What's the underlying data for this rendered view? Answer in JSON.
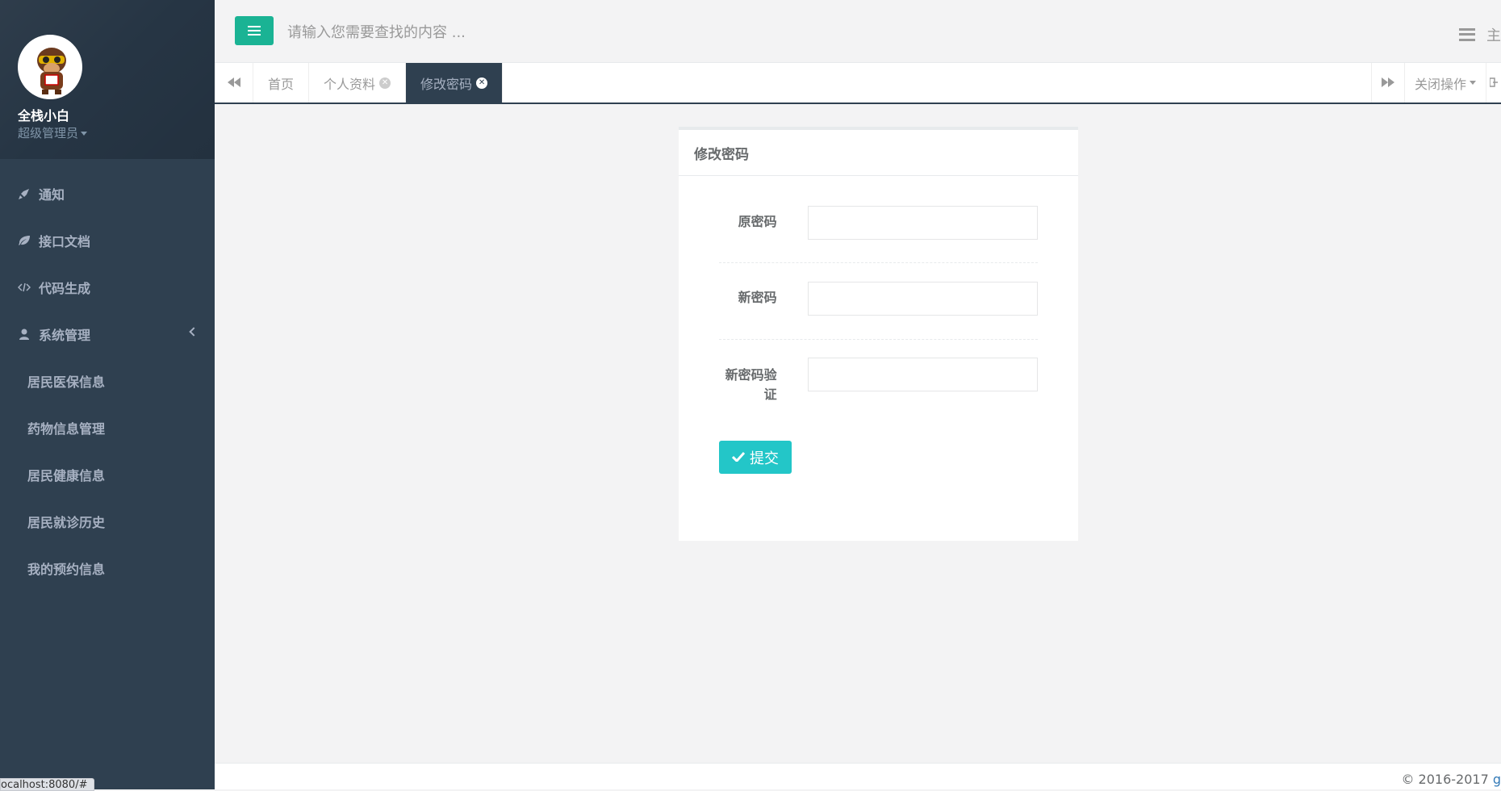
{
  "user": {
    "name": "全栈小白",
    "role": "超级管理员"
  },
  "sidebar": {
    "items": [
      {
        "label": "通知",
        "icon": "rocket-icon"
      },
      {
        "label": "接口文档",
        "icon": "leaf-icon"
      },
      {
        "label": "代码生成",
        "icon": "code-icon"
      },
      {
        "label": "系统管理",
        "icon": "user-icon"
      }
    ],
    "sub_items": [
      {
        "label": "居民医保信息"
      },
      {
        "label": "药物信息管理"
      },
      {
        "label": "居民健康信息"
      },
      {
        "label": "居民就诊历史"
      },
      {
        "label": "我的预约信息"
      }
    ]
  },
  "topbar": {
    "search_placeholder": "请输入您需要查找的内容 ...",
    "right_text": "主"
  },
  "tabs": {
    "items": [
      {
        "label": "首页",
        "closable": false
      },
      {
        "label": "个人资料",
        "closable": true
      },
      {
        "label": "修改密码",
        "closable": true,
        "active": true
      }
    ],
    "close_ops_label": "关闭操作"
  },
  "panel": {
    "title": "修改密码",
    "fields": [
      {
        "label": "原密码",
        "value": ""
      },
      {
        "label": "新密码",
        "value": ""
      },
      {
        "label": "新密码验证",
        "value": ""
      }
    ],
    "submit_label": "提交"
  },
  "footer": {
    "text": "© 2016-2017 ",
    "tail": "g"
  },
  "statusbar": {
    "text": "ocalhost:8080/#"
  },
  "colors": {
    "sidebar": "#2f4050",
    "primary": "#1ab394",
    "info": "#23c6c8"
  }
}
